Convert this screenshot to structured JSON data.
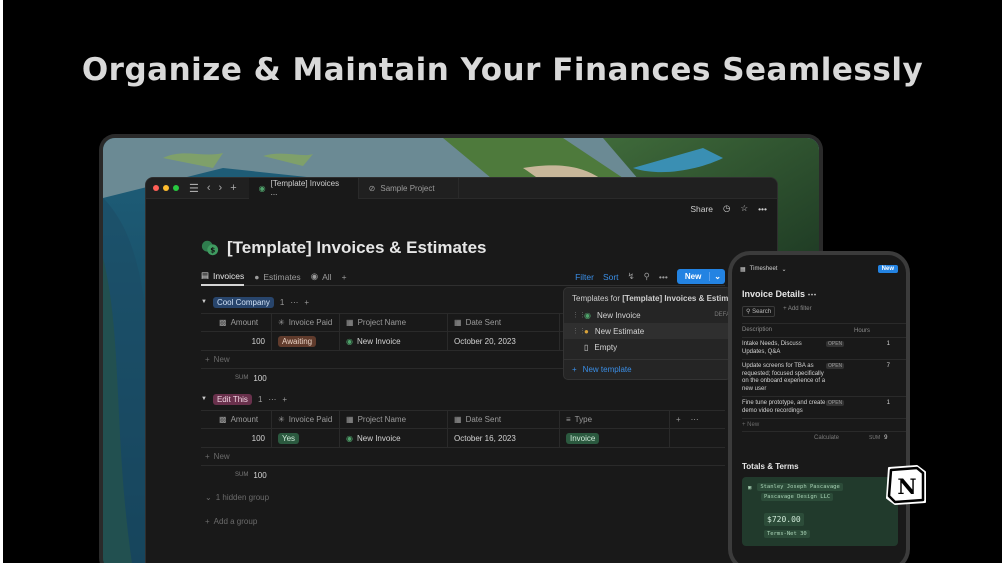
{
  "headline": "Organize & Maintain Your Finances Seamlessly",
  "colors": {
    "accent": "#2383e2",
    "background": "#000000",
    "window": "#191919"
  },
  "window": {
    "tabs": [
      {
        "label": "[Template] Invoices ...",
        "icon": "money-icon"
      },
      {
        "label": "Sample Project",
        "icon": "pin-icon"
      }
    ],
    "top_actions": {
      "share": "Share"
    },
    "page_title": "[Template] Invoices & Estimates",
    "views": [
      {
        "label": "Invoices",
        "icon": "chart-icon"
      },
      {
        "label": "Estimates",
        "icon": "chat-icon"
      },
      {
        "label": "All",
        "icon": "circle-icon"
      }
    ],
    "toolbar": {
      "filter": "Filter",
      "sort": "Sort",
      "new": "New"
    },
    "columns": [
      "Amount",
      "Invoice Paid",
      "Project Name",
      "Date Sent",
      "Type"
    ],
    "groups": [
      {
        "tag": "Cool Company",
        "count": "1",
        "rows": [
          {
            "amount": "100",
            "paid": "Awaiting",
            "project": "New Invoice",
            "date": "October 20, 2023",
            "type": ""
          }
        ],
        "new_label": "New",
        "sum_label": "SUM",
        "sum_value": "100"
      },
      {
        "tag": "Edit This",
        "count": "1",
        "rows": [
          {
            "amount": "100",
            "paid": "Yes",
            "project": "New Invoice",
            "date": "October 16, 2023",
            "type": "Invoice"
          }
        ],
        "new_label": "New",
        "sum_label": "SUM",
        "sum_value": "100"
      }
    ],
    "hidden_group": "1 hidden group",
    "add_group": "Add a group",
    "template_popup": {
      "heading_prefix": "Templates for ",
      "heading_bold": "[Template] Invoices & Estim",
      "default_badge": "DEFA",
      "items": [
        "New Invoice",
        "New Estimate",
        "Empty"
      ],
      "new_template": "New template"
    }
  },
  "phone": {
    "db_name": "Timesheet",
    "new": "New",
    "title": "Invoice Details",
    "search": "Search",
    "add_filter": "+ Add filter",
    "col_description": "Description",
    "col_hours": "Hours",
    "rows": [
      {
        "desc": "Intake Needs, Discuss Updates, Q&A",
        "status": "OPEN",
        "hours": "1"
      },
      {
        "desc": "Update screens for TBA as requested; focused specifically on the onboard experience of a new user",
        "status": "OPEN",
        "hours": "7"
      },
      {
        "desc": "Fine tune prototype, and create demo video recordings",
        "status": "OPEN",
        "hours": "1"
      }
    ],
    "new_row": "+ New",
    "calculate": "Calculate",
    "sum_label": "SUM",
    "sum_value": "9",
    "totals_title": "Totals & Terms",
    "card": {
      "client": "Stanley Joseph Pascavage",
      "company": "Pascavage Design LLC",
      "amount": "$720.00",
      "terms": "Terms-Net 30"
    }
  },
  "logo_letter": "N"
}
